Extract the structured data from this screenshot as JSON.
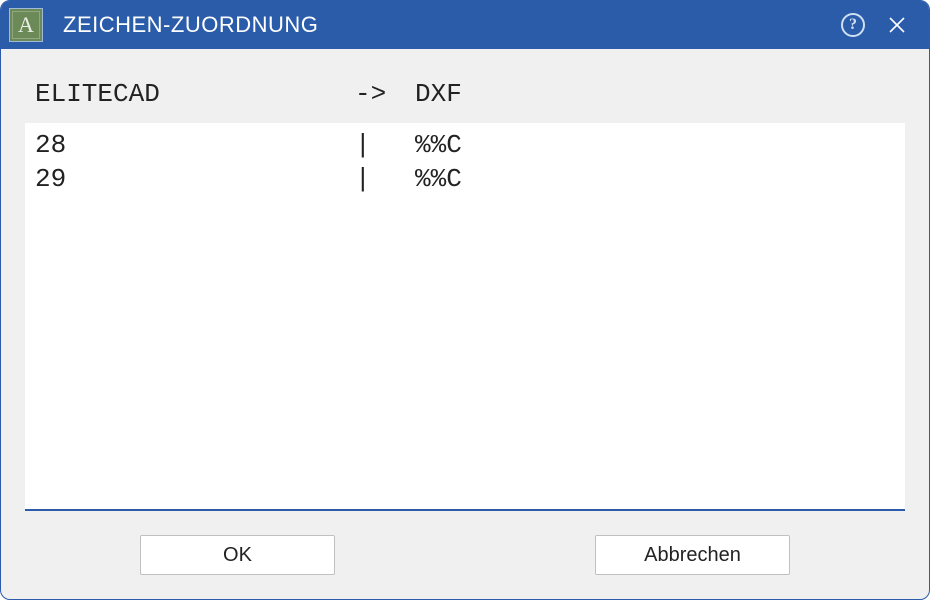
{
  "titlebar": {
    "app_icon_letter": "A",
    "title": "ZEICHEN-ZUORDNUNG",
    "help_glyph": "?"
  },
  "columns": {
    "left_header": "ELITECAD",
    "arrow": "->",
    "right_header": "DXF",
    "separator": "|"
  },
  "rows": [
    {
      "left": "28",
      "right": "%%C"
    },
    {
      "left": "29",
      "right": "%%C"
    }
  ],
  "buttons": {
    "ok": "OK",
    "cancel": "Abbrechen"
  }
}
